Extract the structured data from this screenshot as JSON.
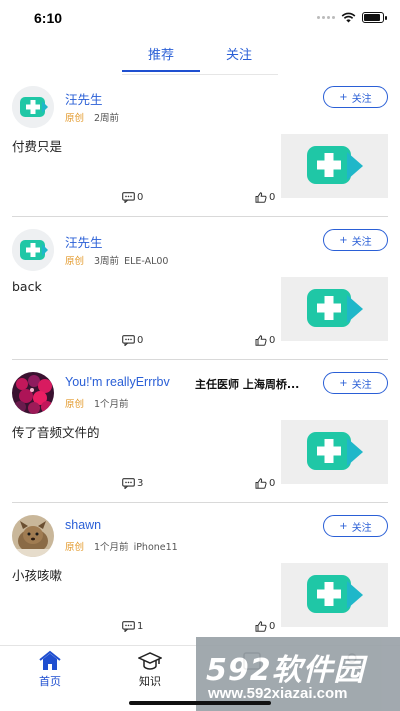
{
  "status_bar": {
    "time": "6:10",
    "battery_level": 0.9
  },
  "tabs": [
    {
      "label": "推荐",
      "active": true
    },
    {
      "label": "关注",
      "active": false
    }
  ],
  "posts": [
    {
      "author": "汪先生",
      "badge": "",
      "origin": "原创",
      "time": "2周前",
      "extra": "",
      "content": "付费只是",
      "comments": "0",
      "likes": "0",
      "follow": "关注",
      "avatar": "app-logo"
    },
    {
      "author": "汪先生",
      "badge": "",
      "origin": "原创",
      "time": "3周前",
      "extra": "ELE-AL00",
      "content": "back",
      "comments": "0",
      "likes": "0",
      "follow": "关注",
      "avatar": "app-logo"
    },
    {
      "author": "You!'m reallyErrrbv",
      "badge": "主任医师 上海周桥...",
      "origin": "原创",
      "time": "1个月前",
      "extra": "",
      "content": "传了音频文件的",
      "comments": "3",
      "likes": "0",
      "follow": "关注",
      "avatar": "flower-photo"
    },
    {
      "author": "shawn",
      "badge": "",
      "origin": "原创",
      "time": "1个月前",
      "extra": "iPhone11",
      "content": "小孩咳嗽",
      "comments": "1",
      "likes": "0",
      "follow": "关注",
      "avatar": "pet-photo"
    }
  ],
  "tabbar": [
    {
      "label": "首页",
      "icon": "home-icon",
      "active": true
    },
    {
      "label": "知识",
      "icon": "graduation-cap-icon",
      "active": false
    },
    {
      "label": "",
      "icon": "calendar-icon",
      "active": false
    },
    {
      "label": "",
      "icon": "user-icon",
      "active": false
    }
  ],
  "watermark": {
    "brand": "592软件园",
    "url": "www.592xiazai.com"
  },
  "colors": {
    "accent": "#2a5fd6",
    "origin": "#e39a2c",
    "logo_teal": "#1fc7a6"
  }
}
